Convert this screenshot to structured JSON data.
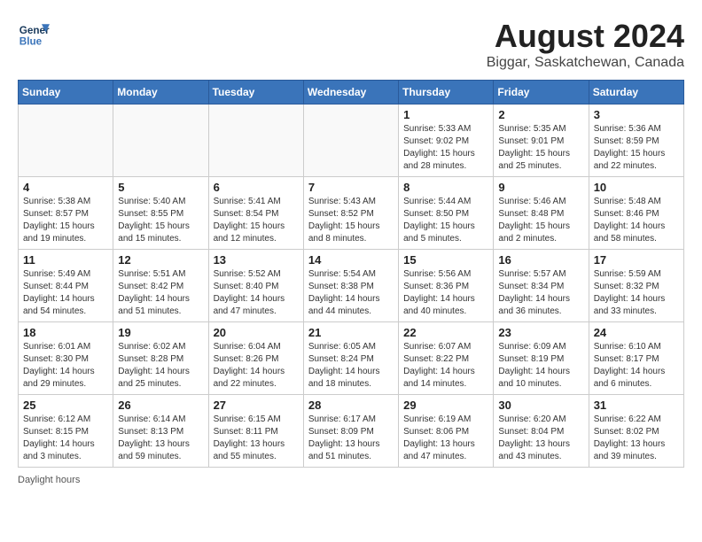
{
  "header": {
    "logo_line1": "General",
    "logo_line2": "Blue",
    "month_year": "August 2024",
    "location": "Biggar, Saskatchewan, Canada"
  },
  "days_of_week": [
    "Sunday",
    "Monday",
    "Tuesday",
    "Wednesday",
    "Thursday",
    "Friday",
    "Saturday"
  ],
  "weeks": [
    [
      {
        "day": "",
        "info": ""
      },
      {
        "day": "",
        "info": ""
      },
      {
        "day": "",
        "info": ""
      },
      {
        "day": "",
        "info": ""
      },
      {
        "day": "1",
        "info": "Sunrise: 5:33 AM\nSunset: 9:02 PM\nDaylight: 15 hours\nand 28 minutes."
      },
      {
        "day": "2",
        "info": "Sunrise: 5:35 AM\nSunset: 9:01 PM\nDaylight: 15 hours\nand 25 minutes."
      },
      {
        "day": "3",
        "info": "Sunrise: 5:36 AM\nSunset: 8:59 PM\nDaylight: 15 hours\nand 22 minutes."
      }
    ],
    [
      {
        "day": "4",
        "info": "Sunrise: 5:38 AM\nSunset: 8:57 PM\nDaylight: 15 hours\nand 19 minutes."
      },
      {
        "day": "5",
        "info": "Sunrise: 5:40 AM\nSunset: 8:55 PM\nDaylight: 15 hours\nand 15 minutes."
      },
      {
        "day": "6",
        "info": "Sunrise: 5:41 AM\nSunset: 8:54 PM\nDaylight: 15 hours\nand 12 minutes."
      },
      {
        "day": "7",
        "info": "Sunrise: 5:43 AM\nSunset: 8:52 PM\nDaylight: 15 hours\nand 8 minutes."
      },
      {
        "day": "8",
        "info": "Sunrise: 5:44 AM\nSunset: 8:50 PM\nDaylight: 15 hours\nand 5 minutes."
      },
      {
        "day": "9",
        "info": "Sunrise: 5:46 AM\nSunset: 8:48 PM\nDaylight: 15 hours\nand 2 minutes."
      },
      {
        "day": "10",
        "info": "Sunrise: 5:48 AM\nSunset: 8:46 PM\nDaylight: 14 hours\nand 58 minutes."
      }
    ],
    [
      {
        "day": "11",
        "info": "Sunrise: 5:49 AM\nSunset: 8:44 PM\nDaylight: 14 hours\nand 54 minutes."
      },
      {
        "day": "12",
        "info": "Sunrise: 5:51 AM\nSunset: 8:42 PM\nDaylight: 14 hours\nand 51 minutes."
      },
      {
        "day": "13",
        "info": "Sunrise: 5:52 AM\nSunset: 8:40 PM\nDaylight: 14 hours\nand 47 minutes."
      },
      {
        "day": "14",
        "info": "Sunrise: 5:54 AM\nSunset: 8:38 PM\nDaylight: 14 hours\nand 44 minutes."
      },
      {
        "day": "15",
        "info": "Sunrise: 5:56 AM\nSunset: 8:36 PM\nDaylight: 14 hours\nand 40 minutes."
      },
      {
        "day": "16",
        "info": "Sunrise: 5:57 AM\nSunset: 8:34 PM\nDaylight: 14 hours\nand 36 minutes."
      },
      {
        "day": "17",
        "info": "Sunrise: 5:59 AM\nSunset: 8:32 PM\nDaylight: 14 hours\nand 33 minutes."
      }
    ],
    [
      {
        "day": "18",
        "info": "Sunrise: 6:01 AM\nSunset: 8:30 PM\nDaylight: 14 hours\nand 29 minutes."
      },
      {
        "day": "19",
        "info": "Sunrise: 6:02 AM\nSunset: 8:28 PM\nDaylight: 14 hours\nand 25 minutes."
      },
      {
        "day": "20",
        "info": "Sunrise: 6:04 AM\nSunset: 8:26 PM\nDaylight: 14 hours\nand 22 minutes."
      },
      {
        "day": "21",
        "info": "Sunrise: 6:05 AM\nSunset: 8:24 PM\nDaylight: 14 hours\nand 18 minutes."
      },
      {
        "day": "22",
        "info": "Sunrise: 6:07 AM\nSunset: 8:22 PM\nDaylight: 14 hours\nand 14 minutes."
      },
      {
        "day": "23",
        "info": "Sunrise: 6:09 AM\nSunset: 8:19 PM\nDaylight: 14 hours\nand 10 minutes."
      },
      {
        "day": "24",
        "info": "Sunrise: 6:10 AM\nSunset: 8:17 PM\nDaylight: 14 hours\nand 6 minutes."
      }
    ],
    [
      {
        "day": "25",
        "info": "Sunrise: 6:12 AM\nSunset: 8:15 PM\nDaylight: 14 hours\nand 3 minutes."
      },
      {
        "day": "26",
        "info": "Sunrise: 6:14 AM\nSunset: 8:13 PM\nDaylight: 13 hours\nand 59 minutes."
      },
      {
        "day": "27",
        "info": "Sunrise: 6:15 AM\nSunset: 8:11 PM\nDaylight: 13 hours\nand 55 minutes."
      },
      {
        "day": "28",
        "info": "Sunrise: 6:17 AM\nSunset: 8:09 PM\nDaylight: 13 hours\nand 51 minutes."
      },
      {
        "day": "29",
        "info": "Sunrise: 6:19 AM\nSunset: 8:06 PM\nDaylight: 13 hours\nand 47 minutes."
      },
      {
        "day": "30",
        "info": "Sunrise: 6:20 AM\nSunset: 8:04 PM\nDaylight: 13 hours\nand 43 minutes."
      },
      {
        "day": "31",
        "info": "Sunrise: 6:22 AM\nSunset: 8:02 PM\nDaylight: 13 hours\nand 39 minutes."
      }
    ]
  ],
  "footer": {
    "note": "Daylight hours"
  }
}
